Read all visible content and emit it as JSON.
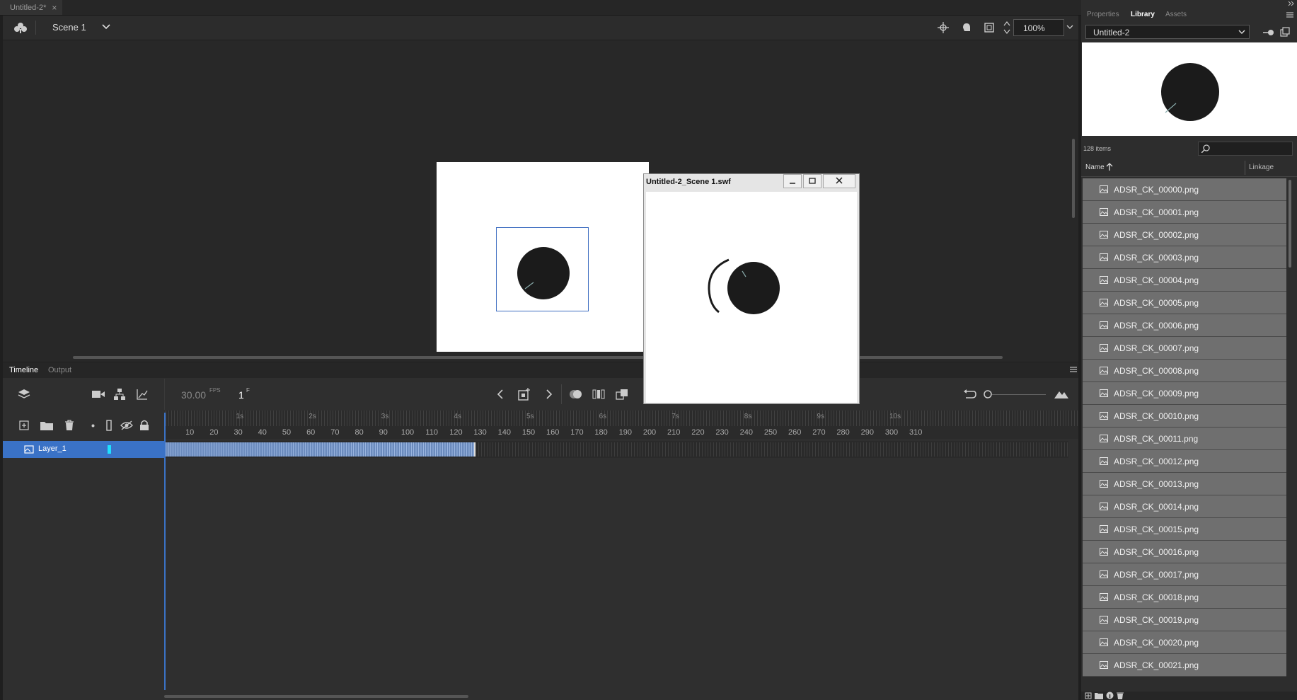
{
  "document": {
    "tab_title": "Untitled-2*",
    "close_glyph": "×"
  },
  "stage_toolbar": {
    "scene_label": "Scene 1",
    "zoom_value": "100%"
  },
  "timeline": {
    "tabs": [
      "Timeline",
      "Output"
    ],
    "fps_value": "30.00",
    "fps_unit": "FPS",
    "current_frame": "1",
    "frame_unit": "F",
    "layer_name": "Layer_1",
    "ruler_numbers": [
      "10",
      "20",
      "30",
      "40",
      "50",
      "60",
      "70",
      "80",
      "90",
      "100",
      "110",
      "120",
      "130",
      "140",
      "150",
      "160",
      "170",
      "180",
      "190",
      "200",
      "210",
      "220",
      "230",
      "240",
      "250",
      "260",
      "270",
      "280",
      "290",
      "300",
      "310"
    ],
    "ruler_seconds": [
      "1s",
      "2s",
      "3s",
      "4s",
      "5s",
      "6s",
      "7s",
      "8s",
      "9s",
      "10s"
    ],
    "filled_frames": 128
  },
  "swf_window": {
    "title": "Untitled-2_Scene 1.swf"
  },
  "right_panel": {
    "tabs": [
      "Properties",
      "Library",
      "Assets"
    ],
    "active_tab": "Library",
    "library_select": "Untitled-2",
    "item_count": "128 items",
    "search_placeholder": "",
    "col_name": "Name",
    "col_linkage": "Linkage",
    "items": [
      "ADSR_CK_00000.png",
      "ADSR_CK_00001.png",
      "ADSR_CK_00002.png",
      "ADSR_CK_00003.png",
      "ADSR_CK_00004.png",
      "ADSR_CK_00005.png",
      "ADSR_CK_00006.png",
      "ADSR_CK_00007.png",
      "ADSR_CK_00008.png",
      "ADSR_CK_00009.png",
      "ADSR_CK_00010.png",
      "ADSR_CK_00011.png",
      "ADSR_CK_00012.png",
      "ADSR_CK_00013.png",
      "ADSR_CK_00014.png",
      "ADSR_CK_00015.png",
      "ADSR_CK_00016.png",
      "ADSR_CK_00017.png",
      "ADSR_CK_00018.png",
      "ADSR_CK_00019.png",
      "ADSR_CK_00020.png",
      "ADSR_CK_00021.png"
    ]
  },
  "colors": {
    "accent": "#3a72c6",
    "panel": "#2d2d2d",
    "library_item": "#6f6f6f"
  }
}
